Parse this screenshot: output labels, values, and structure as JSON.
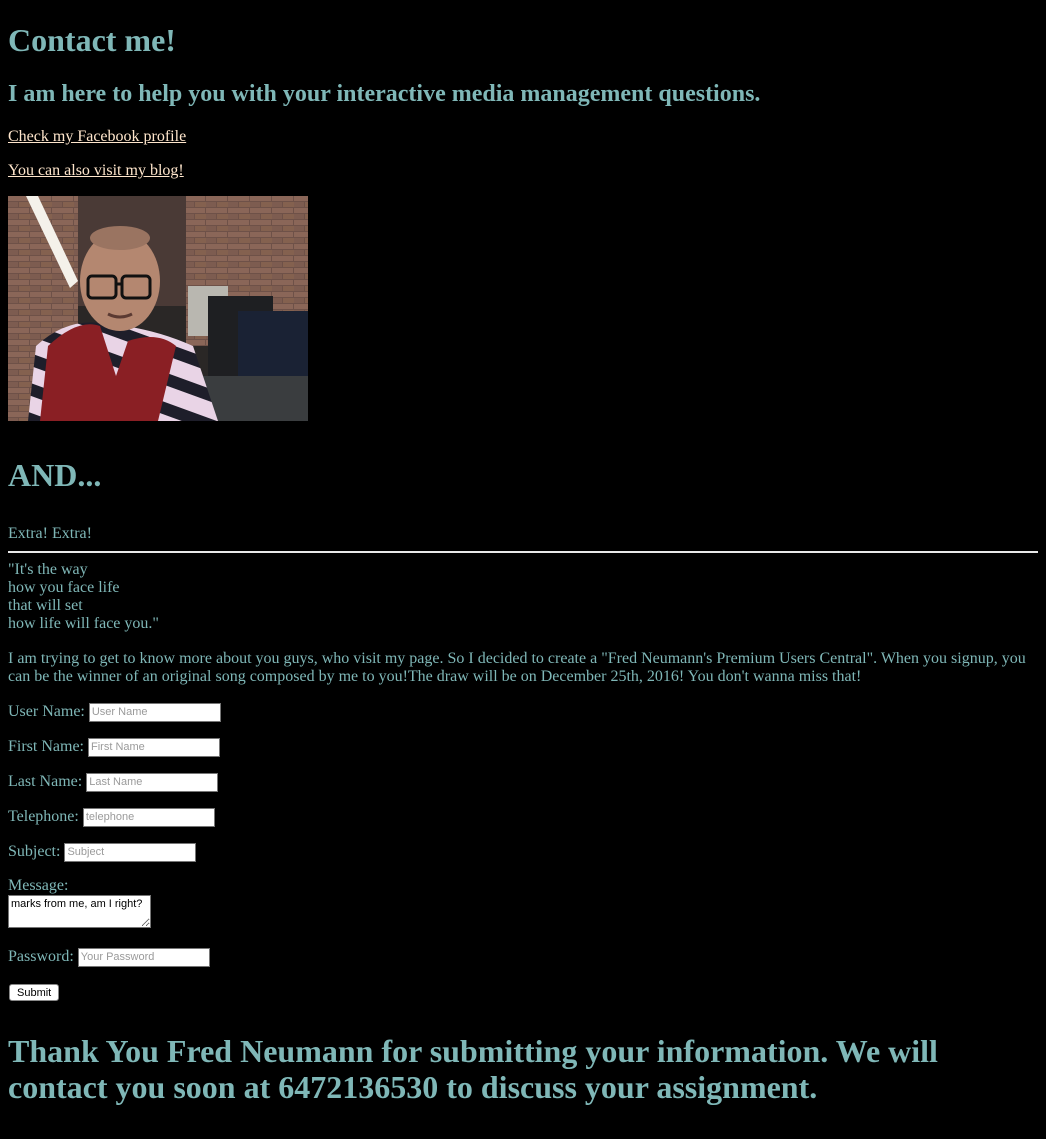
{
  "header": {
    "title": "Contact me!",
    "subtitle": "I am here to help you with your interactive media management questions."
  },
  "links": {
    "facebook": "Check my Facebook profile",
    "blog": "You can also visit my blog!"
  },
  "photo": {
    "alt": "profile photo"
  },
  "section": {
    "and_heading": "AND...",
    "extra": "Extra! Extra!"
  },
  "quote": {
    "line1": "\"It's the way",
    "line2": "how you face life",
    "line3": "that will set",
    "line4": "how life will face you.\""
  },
  "intro": "I am trying to get to know more about you guys, who visit my page. So I decided to create a \"Fred Neumann's Premium Users Central\". When you signup, you can be the winner of an original song composed by me to you!The draw will be on December 25th, 2016! You don't wanna miss that!",
  "form": {
    "username_label": "User Name:",
    "username_placeholder": "User Name",
    "firstname_label": "First Name:",
    "firstname_placeholder": "First Name",
    "lastname_label": "Last Name:",
    "lastname_placeholder": "Last Name",
    "telephone_label": "Telephone:",
    "telephone_placeholder": "telephone",
    "subject_label": "Subject:",
    "subject_placeholder": "Subject",
    "message_label": "Message:",
    "message_value": "marks from me, am I right?",
    "password_label": "Password:",
    "password_placeholder": "Your Password",
    "submit_label": "Submit"
  },
  "thanks": "Thank You Fred Neumann for submitting your information. We will contact you soon at 6472136530 to discuss your assignment.",
  "colors": {
    "background": "#000000",
    "text": "#7fb7b7",
    "link": "#ffe6cc",
    "rule": "#e8e8e8"
  }
}
